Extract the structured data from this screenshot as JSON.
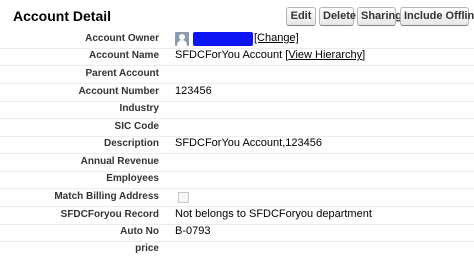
{
  "header": {
    "title": "Account Detail",
    "buttons": {
      "edit": "Edit",
      "delete": "Delete",
      "sharing": "Sharing",
      "include_offline": "Include Offline"
    }
  },
  "fields": {
    "account_owner": {
      "label": "Account Owner",
      "value_link": "[Change]"
    },
    "account_name": {
      "label": "Account Name",
      "value": "SFDCForYou Account",
      "link_open": "[",
      "link": "View Hierarchy",
      "link_close": "]"
    },
    "parent_account": {
      "label": "Parent Account",
      "value": ""
    },
    "account_number": {
      "label": "Account Number",
      "value": "123456"
    },
    "industry": {
      "label": "Industry",
      "value": ""
    },
    "sic_code": {
      "label": "SIC Code",
      "value": ""
    },
    "description": {
      "label": "Description",
      "value": "SFDCForYou Account,123456"
    },
    "annual_revenue": {
      "label": "Annual Revenue",
      "value": ""
    },
    "employees": {
      "label": "Employees",
      "value": ""
    },
    "match_billing_address": {
      "label": "Match Billing Address",
      "checked": false
    },
    "sfdcforyou_record": {
      "label": "SFDCForyou Record",
      "value": "Not belongs to SFDCForyou department"
    },
    "auto_no": {
      "label": "Auto No",
      "value": "B-0793"
    },
    "price": {
      "label": "price",
      "value": ""
    }
  },
  "icons": {
    "owner_avatar": "user-avatar-icon",
    "checkbox": "checkbox-icon"
  }
}
